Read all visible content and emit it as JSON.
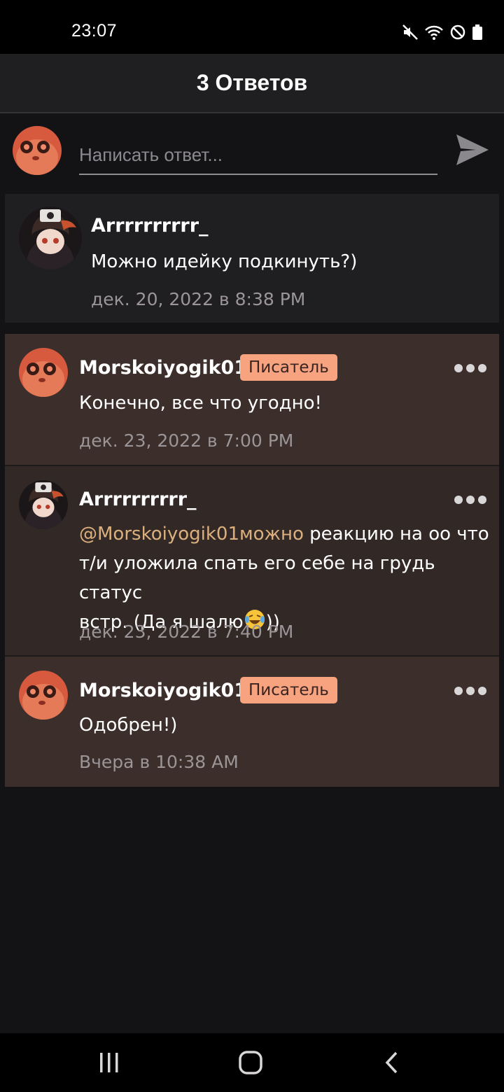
{
  "status_bar": {
    "time": "23:07",
    "icons": [
      "mute-icon",
      "wifi-icon",
      "do-not-disturb-icon",
      "battery-icon"
    ]
  },
  "header": {
    "title": "3 Ответов"
  },
  "reply_bar": {
    "placeholder": "Написать ответ..."
  },
  "root_comment": {
    "author": "Arrrrrrrrrr_",
    "text": "Можно идейку подкинуть?)",
    "time": "дек. 20, 2022 в 8:38 PM"
  },
  "replies": [
    {
      "author": "Morskoiyogik01",
      "badge": "Писатель",
      "text": "Конечно, все что угодно!",
      "time": "дек. 23, 2022 в 7:00 PM"
    },
    {
      "author": "Arrrrrrrrrr_",
      "mention": "@Morskoiyogik01можно",
      "text_line1": "реакцию на оо что",
      "text_line2": "т/и уложила спать его себе на грудь статус",
      "text_line3": "встр. (Да я шалю",
      "text_line3_end": "))",
      "time": "дек. 23, 2022 в 7:40 PM"
    },
    {
      "author": "Morskoiyogik01",
      "badge": "Писатель",
      "text": "Одобрен!)",
      "time": "Вчера в 10:38 AM"
    }
  ],
  "colors": {
    "background": "#131214",
    "reply_card": "#3c2e2b",
    "badge": "#f7a380",
    "mention": "#dcb07d"
  }
}
